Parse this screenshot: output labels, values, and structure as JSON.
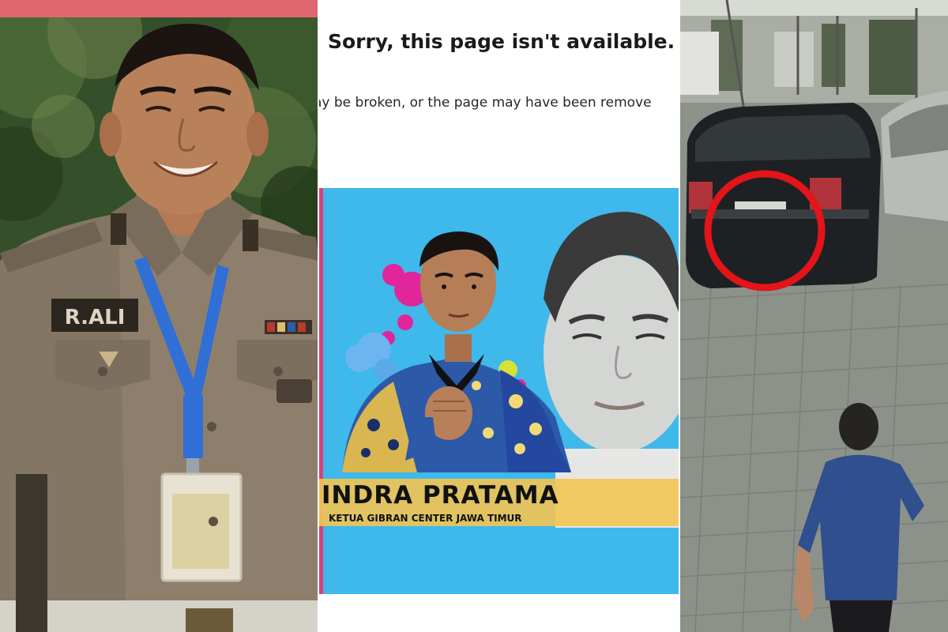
{
  "colors": {
    "pink_bar": "#e0676f",
    "cyan_bg": "#3fb8ec",
    "gold_band": "#f3c552",
    "red_circle": "#e3141a",
    "uniform": "#8e7f6d",
    "lanyard": "#2f6fd6"
  },
  "left_photo": {
    "name_tag": "R.ALI"
  },
  "middle": {
    "error": {
      "title": "Sorry, this page isn't available.",
      "message": "ay be broken, or the page may have been remove"
    },
    "poster": {
      "name": "INDRA PRATAMA",
      "role": "KETUA GIBRAN CENTER JAWA TIMUR"
    }
  }
}
